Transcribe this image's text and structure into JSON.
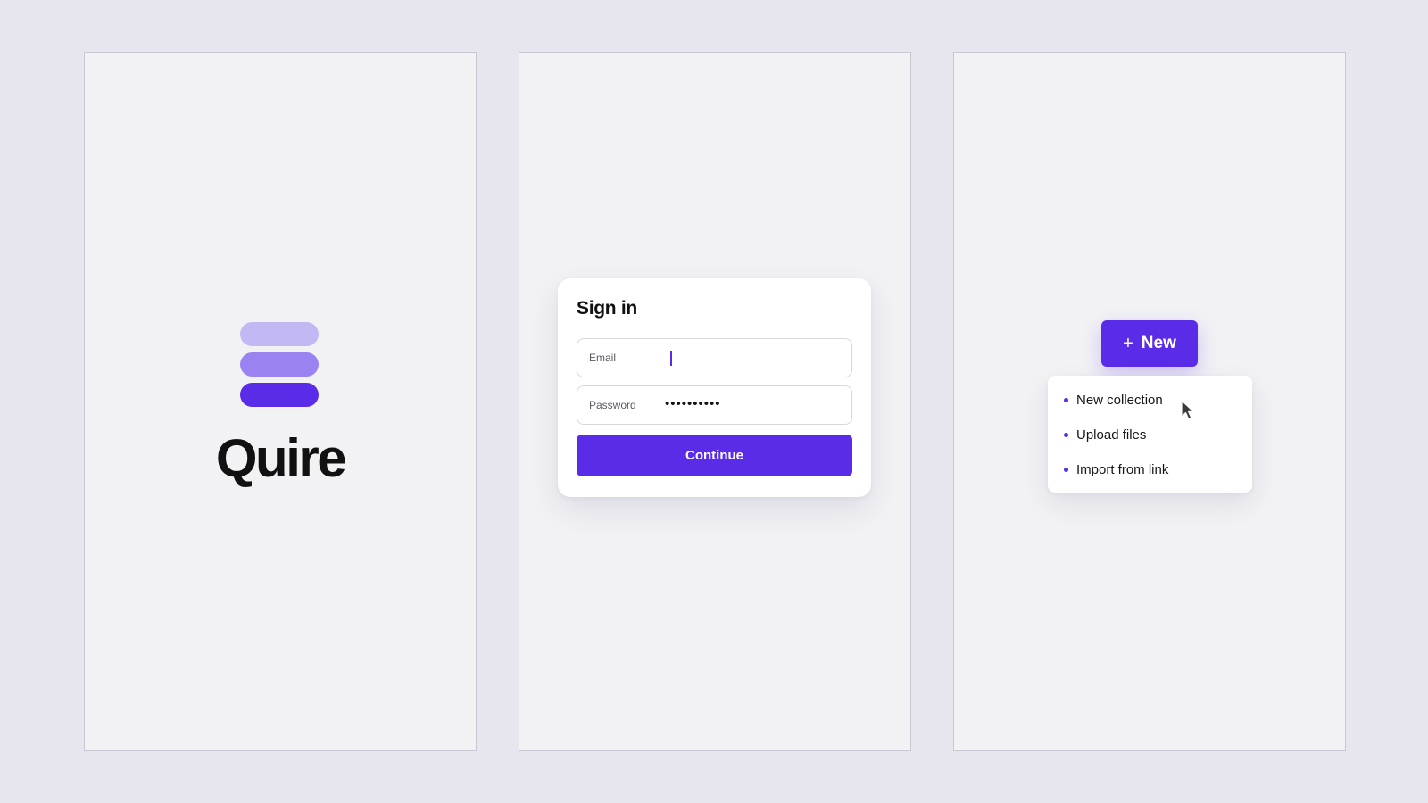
{
  "panels": [
    {
      "id": "splash",
      "brand": {
        "name": "Quire",
        "logo_icon": "stacked-bars-logo",
        "logo_colors": [
          "#c2b9f4",
          "#9a83f0",
          "#5a2ce8"
        ]
      }
    },
    {
      "id": "sign-in",
      "title": "Sign in",
      "email_label": "Email",
      "email_value": "",
      "password_label": "Password",
      "password_value": "••••••••••",
      "continue_label": "Continue"
    },
    {
      "id": "new-menu",
      "new_button": {
        "icon": "plus-icon",
        "icon_glyph": "+",
        "label": "New"
      },
      "menu_items": [
        {
          "label": "New collection",
          "hovered": true
        },
        {
          "label": "Upload files"
        },
        {
          "label": "Import from link"
        }
      ],
      "cursor_icon": "pointer-cursor-icon"
    }
  ],
  "colors": {
    "accent": "#5a2ce8",
    "background": "#e7e5ee",
    "panel": "#f2f2f5",
    "text": "#111111"
  }
}
